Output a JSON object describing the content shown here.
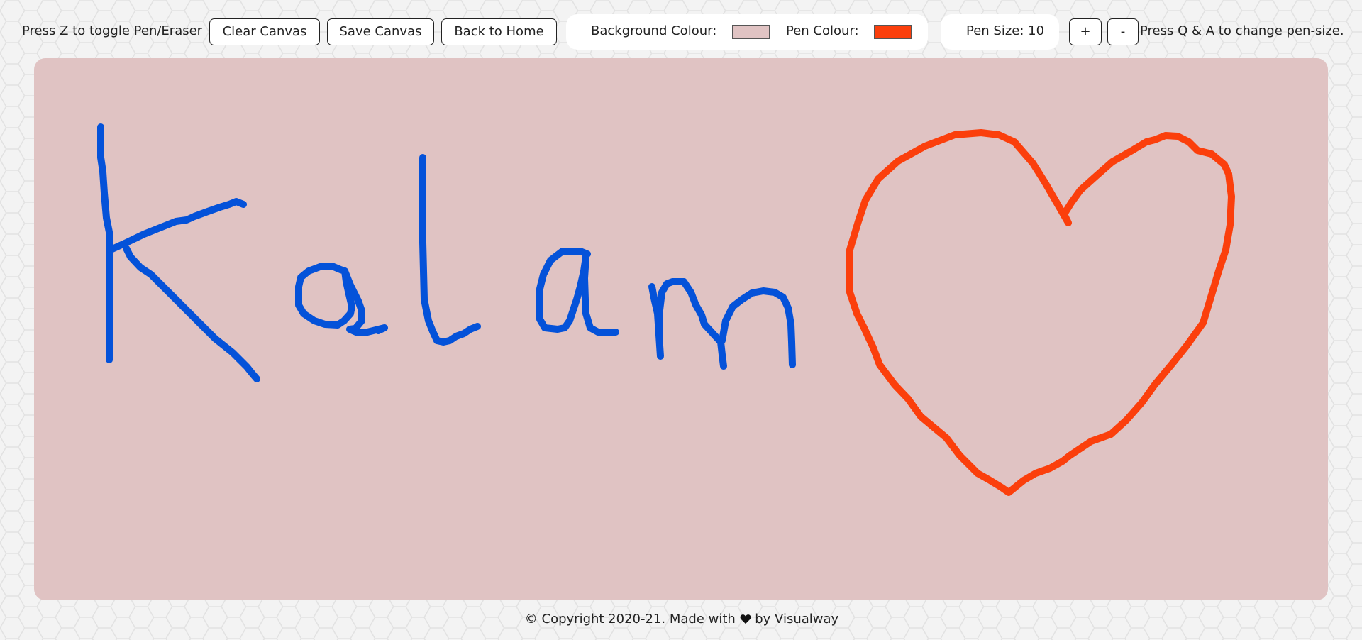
{
  "toolbar": {
    "toggle_hint": "Press Z to toggle Pen/Eraser",
    "clear_label": "Clear Canvas",
    "save_label": "Save Canvas",
    "home_label": "Back to Home",
    "background_label": "Background Colour:",
    "background_color": "#e0c3c3",
    "pen_label": "Pen Colour:",
    "pen_color": "#fb3f0c",
    "pen_size_label": "Pen Size: 10",
    "increase_label": "+",
    "decrease_label": "-",
    "size_hint": "Press Q & A to change pen-size."
  },
  "canvas": {
    "background_color": "#e0c3c3",
    "drawing_colors": [
      "#0452d9",
      "#fb3f0c"
    ]
  },
  "footer": {
    "text_before": "© Copyright 2020-21. Made with ",
    "heart_icon": "heart-icon",
    "text_after": " by Visualway"
  }
}
